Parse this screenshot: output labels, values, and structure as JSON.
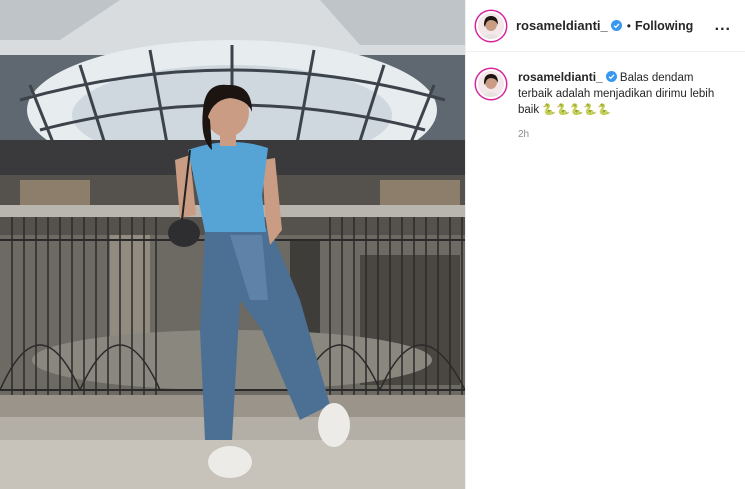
{
  "post": {
    "username": "rosameldianti_",
    "follow_separator": "•",
    "follow_status": "Following",
    "more_label": "...",
    "caption_prefix": "Balas dendam terbaik adalah menjadikan dirimu lebih baik",
    "emoji": "🐍🐍🐍🐍🐍",
    "timestamp": "2h"
  },
  "icons": {
    "verified": "verified-badge-icon",
    "more": "more-options-icon",
    "emoji": "snake-emoji-icon"
  },
  "colors": {
    "verified_blue": "#3897f0",
    "story_ring": "#d6249f",
    "text": "#262626",
    "muted": "#8e8e8e"
  }
}
